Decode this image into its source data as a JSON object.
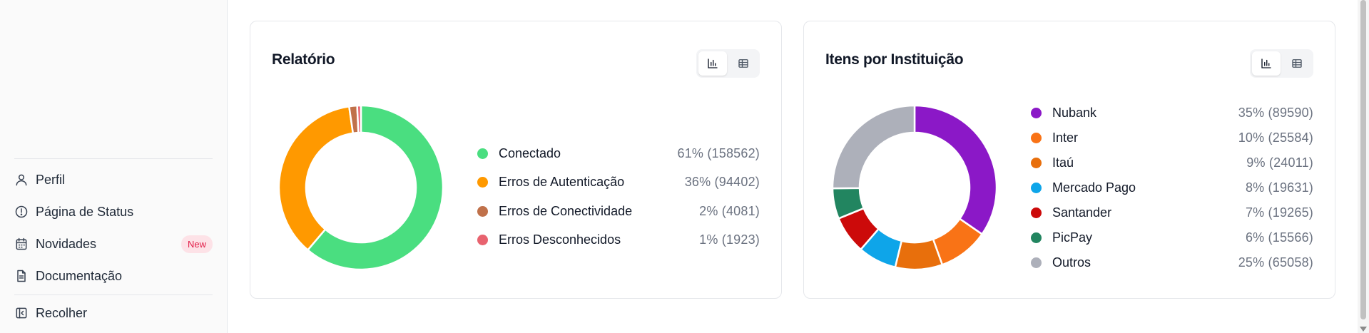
{
  "sidebar": {
    "items": [
      {
        "label": "Perfil",
        "icon": "user-icon"
      },
      {
        "label": "Página de Status",
        "icon": "alert-circle-icon"
      },
      {
        "label": "Novidades",
        "icon": "calendar-icon",
        "badge": "New"
      },
      {
        "label": "Documentação",
        "icon": "document-icon"
      }
    ],
    "collapse_label": "Recolher",
    "collapse_icon": "collapse-sidebar-icon"
  },
  "cards": [
    {
      "title": "Relatório",
      "toggle": {
        "active": "bar-chart-icon",
        "other": "table-icon"
      },
      "legend": [
        {
          "label": "Conectado",
          "value": "61% (158562)"
        },
        {
          "label": "Erros de Autenticação",
          "value": "36% (94402)"
        },
        {
          "label": "Erros de Conectividade",
          "value": "2% (4081)"
        },
        {
          "label": "Erros Desconhecidos",
          "value": "1% (1923)"
        }
      ]
    },
    {
      "title": "Itens por Instituição",
      "toggle": {
        "active": "bar-chart-icon",
        "other": "table-icon"
      },
      "legend": [
        {
          "label": "Nubank",
          "value": "35% (89590)"
        },
        {
          "label": "Inter",
          "value": "10% (25584)"
        },
        {
          "label": "Itaú",
          "value": "9% (24011)"
        },
        {
          "label": "Mercado Pago",
          "value": "8% (19631)"
        },
        {
          "label": "Santander",
          "value": "7% (19265)"
        },
        {
          "label": "PicPay",
          "value": "6% (15566)"
        },
        {
          "label": "Outros",
          "value": "25% (65058)"
        }
      ]
    }
  ],
  "chart_data": [
    {
      "type": "pie",
      "title": "Relatório",
      "categories": [
        "Conectado",
        "Erros de Autenticação",
        "Erros de Conectividade",
        "Erros Desconhecidos"
      ],
      "values": [
        158562,
        94402,
        4081,
        1923
      ],
      "percent": [
        61,
        36,
        2,
        1
      ],
      "colors": [
        "#4ade80",
        "#ff9900",
        "#c0714a",
        "#e8636f"
      ],
      "legend_position": "right"
    },
    {
      "type": "pie",
      "title": "Itens por Instituição",
      "categories": [
        "Nubank",
        "Inter",
        "Itaú",
        "Mercado Pago",
        "Santander",
        "PicPay",
        "Outros"
      ],
      "values": [
        89590,
        25584,
        24011,
        19631,
        19265,
        15566,
        65058
      ],
      "percent": [
        35,
        10,
        9,
        8,
        7,
        6,
        25
      ],
      "colors": [
        "#8b18c7",
        "#f97316",
        "#e86f0c",
        "#0ea5e9",
        "#cc0a0a",
        "#228560",
        "#adb0ba"
      ],
      "legend_position": "right"
    }
  ]
}
